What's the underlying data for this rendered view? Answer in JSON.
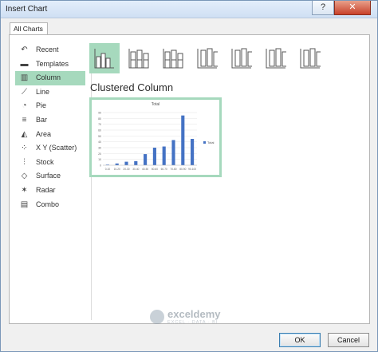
{
  "window": {
    "title": "Insert Chart",
    "help_label": "?",
    "close_label": "✕"
  },
  "tabs": [
    {
      "label": "All Charts"
    }
  ],
  "sidebar": {
    "items": [
      {
        "label": "Recent",
        "icon": "recent-icon",
        "glyph": "↶"
      },
      {
        "label": "Templates",
        "icon": "folder-icon",
        "glyph": "▬"
      },
      {
        "label": "Column",
        "icon": "column-chart-icon",
        "glyph": "▥",
        "selected": true
      },
      {
        "label": "Line",
        "icon": "line-chart-icon",
        "glyph": "⟋"
      },
      {
        "label": "Pie",
        "icon": "pie-chart-icon",
        "glyph": "◔"
      },
      {
        "label": "Bar",
        "icon": "bar-chart-icon",
        "glyph": "≡"
      },
      {
        "label": "Area",
        "icon": "area-chart-icon",
        "glyph": "◭"
      },
      {
        "label": "X Y (Scatter)",
        "icon": "scatter-chart-icon",
        "glyph": "⁘"
      },
      {
        "label": "Stock",
        "icon": "stock-chart-icon",
        "glyph": "⫶"
      },
      {
        "label": "Surface",
        "icon": "surface-chart-icon",
        "glyph": "◇"
      },
      {
        "label": "Radar",
        "icon": "radar-chart-icon",
        "glyph": "✶"
      },
      {
        "label": "Combo",
        "icon": "combo-chart-icon",
        "glyph": "▤"
      }
    ]
  },
  "subtypes": [
    {
      "icon": "clustered-column-icon",
      "selected": true
    },
    {
      "icon": "stacked-column-icon"
    },
    {
      "icon": "100-stacked-column-icon"
    },
    {
      "icon": "3d-clustered-column-icon"
    },
    {
      "icon": "3d-stacked-column-icon"
    },
    {
      "icon": "3d-100-stacked-column-icon"
    },
    {
      "icon": "3d-column-icon"
    }
  ],
  "section_title": "Clustered Column",
  "preview": {
    "title": "Total",
    "legend": "Total",
    "colors": {
      "bar": "#4472c4",
      "accent": "#a6d9bd"
    }
  },
  "chart_data": {
    "type": "bar",
    "title": "Total",
    "categories": [
      "0-10",
      "10-20",
      "20-30",
      "30-40",
      "40-50",
      "50-60",
      "60-70",
      "70-80",
      "80-90",
      "90-100"
    ],
    "series": [
      {
        "name": "Total",
        "values": [
          1,
          3,
          6,
          7,
          19,
          30,
          32,
          43,
          85,
          45
        ]
      }
    ],
    "ylim": [
      0,
      90
    ],
    "yticks": [
      0,
      10,
      20,
      30,
      40,
      50,
      60,
      70,
      80,
      90
    ],
    "xlabel": "",
    "ylabel": "",
    "grid": true,
    "legend_position": "right"
  },
  "footer": {
    "ok_label": "OK",
    "cancel_label": "Cancel"
  },
  "watermark": {
    "brand": "exceldemy",
    "tagline": "EXCEL · DATA · BI"
  }
}
